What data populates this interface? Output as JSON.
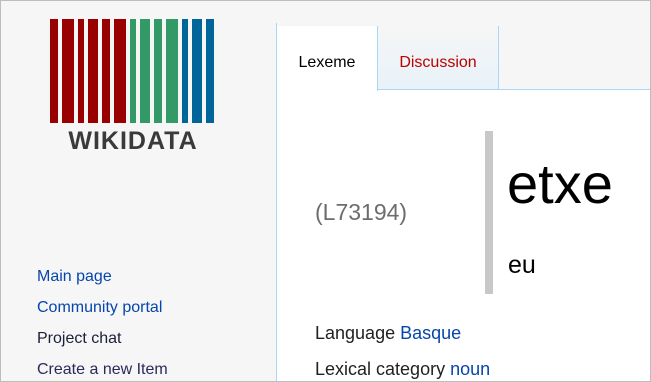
{
  "logo": {
    "wordmark": "WIKIDATA",
    "bar_colors": [
      "#990000",
      "#990000",
      "#339966",
      "#339966",
      "#006699",
      "#006699",
      "#339966",
      "#990000"
    ]
  },
  "sidebar": {
    "items": [
      {
        "label": "Main page"
      },
      {
        "label": "Community portal"
      },
      {
        "label": "Project chat"
      },
      {
        "label": "Create a new Item"
      }
    ]
  },
  "tabs": [
    {
      "label": "Lexeme",
      "selected": true
    },
    {
      "label": "Discussion",
      "selected": false
    }
  ],
  "lexeme": {
    "id": "(L73194)",
    "lemma": "etxe",
    "language_code": "eu"
  },
  "statements": {
    "language_label": "Language",
    "language_value": "Basque",
    "category_label": "Lexical category",
    "category_value": "noun"
  }
}
